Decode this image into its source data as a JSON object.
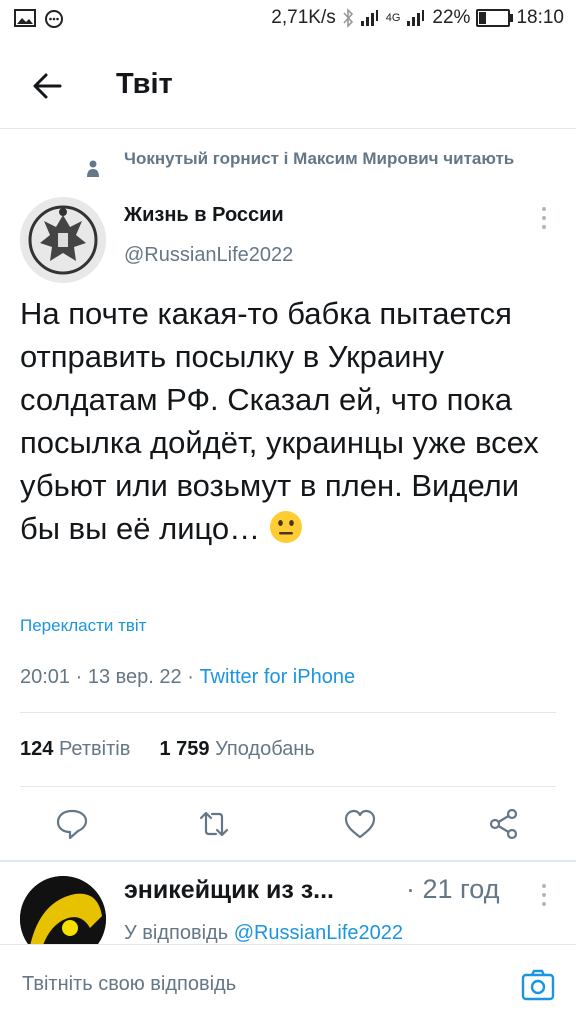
{
  "status_bar": {
    "net_speed": "2,71K/s",
    "network": "4G",
    "battery": "22%",
    "battery_level": 0.22,
    "time": "18:10"
  },
  "header": {
    "title": "Твіт"
  },
  "tweet": {
    "social_context": "Чокнутый горнист і Максим Мирович читають",
    "author_name": "Жизнь в России",
    "author_handle": "@RussianLife2022",
    "text": "На почте какая-то бабка пытается отправить посылку в Украину солдатам РФ. Сказал ей, что пока посылка дойдёт, украинцы уже всех убьют или возьмут в плен. Видели бы вы её лицо…",
    "translate": "Перекласти твіт",
    "time": "20:01",
    "date": "13 вер. 22",
    "source": "Twitter for iPhone",
    "retweets_count": "124",
    "retweets_label": "Ретвітів",
    "likes_count": "1 759",
    "likes_label": "Уподобань"
  },
  "reply": {
    "author": "эникейщик из з...",
    "time": "21 год",
    "reply_prefix": "У відповідь",
    "reply_to": "@RussianLife2022"
  },
  "compose": {
    "placeholder": "Твітніть свою відповідь"
  },
  "colors": {
    "link": "#1b95e0",
    "muted": "#657786",
    "text": "#14171a",
    "divider": "#e1e8ed"
  },
  "icons": [
    "back-arrow-icon",
    "person-icon",
    "more-icon",
    "reply-icon",
    "retweet-icon",
    "like-icon",
    "share-icon",
    "camera-icon"
  ]
}
